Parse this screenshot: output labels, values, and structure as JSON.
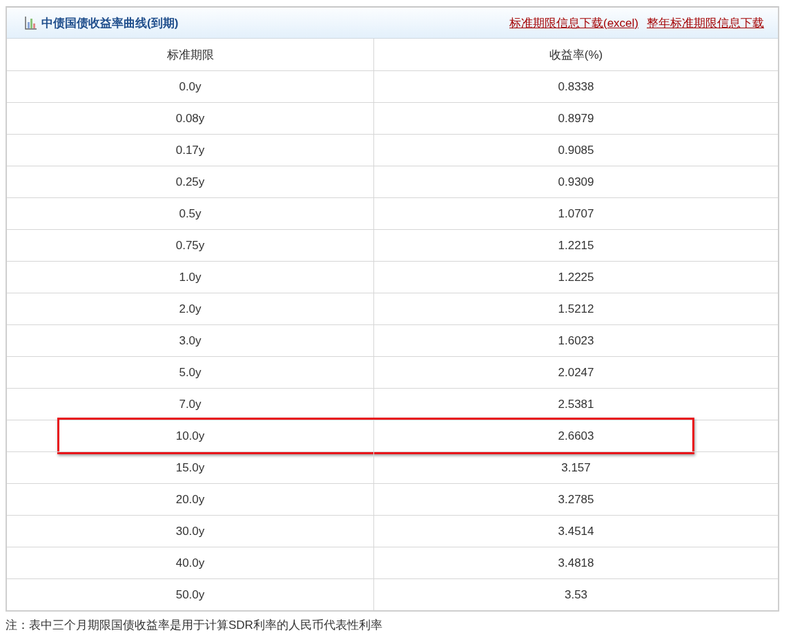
{
  "panel": {
    "title": "中债国债收益率曲线(到期)",
    "links": [
      "标准期限信息下载(excel)",
      "整年标准期限信息下载"
    ]
  },
  "table": {
    "columns": [
      "标准期限",
      "收益率(%)"
    ],
    "rows": [
      {
        "cells": [
          "0.0y",
          "0.8338"
        ],
        "highlighted": false
      },
      {
        "cells": [
          "0.08y",
          "0.8979"
        ],
        "highlighted": false
      },
      {
        "cells": [
          "0.17y",
          "0.9085"
        ],
        "highlighted": false
      },
      {
        "cells": [
          "0.25y",
          "0.9309"
        ],
        "highlighted": false
      },
      {
        "cells": [
          "0.5y",
          "1.0707"
        ],
        "highlighted": false
      },
      {
        "cells": [
          "0.75y",
          "1.2215"
        ],
        "highlighted": false
      },
      {
        "cells": [
          "1.0y",
          "1.2225"
        ],
        "highlighted": false
      },
      {
        "cells": [
          "2.0y",
          "1.5212"
        ],
        "highlighted": false
      },
      {
        "cells": [
          "3.0y",
          "1.6023"
        ],
        "highlighted": false
      },
      {
        "cells": [
          "5.0y",
          "2.0247"
        ],
        "highlighted": false
      },
      {
        "cells": [
          "7.0y",
          "2.5381"
        ],
        "highlighted": false
      },
      {
        "cells": [
          "10.0y",
          "2.6603"
        ],
        "highlighted": true
      },
      {
        "cells": [
          "15.0y",
          "3.157"
        ],
        "highlighted": false
      },
      {
        "cells": [
          "20.0y",
          "3.2785"
        ],
        "highlighted": false
      },
      {
        "cells": [
          "30.0y",
          "3.4514"
        ],
        "highlighted": false
      },
      {
        "cells": [
          "40.0y",
          "3.4818"
        ],
        "highlighted": false
      },
      {
        "cells": [
          "50.0y",
          "3.53"
        ],
        "highlighted": false
      }
    ]
  },
  "note": "注：表中三个月期限国债收益率是用于计算SDR利率的人民币代表性利率"
}
